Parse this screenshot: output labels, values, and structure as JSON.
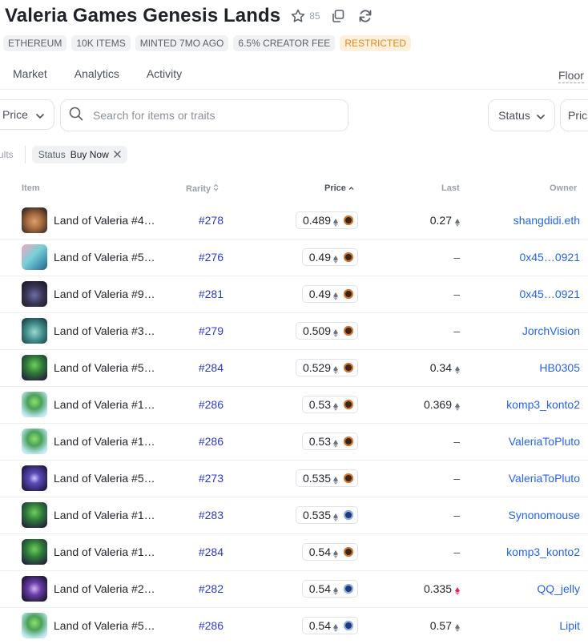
{
  "collection": {
    "title": "Valeria Games Genesis Lands",
    "favorites_count": "85"
  },
  "chips": [
    {
      "label": "ETHEREUM"
    },
    {
      "label": "10K ITEMS"
    },
    {
      "label": "MINTED 7MO AGO"
    },
    {
      "label": "6.5% CREATOR FEE"
    },
    {
      "label": "RESTRICTED"
    }
  ],
  "tabs": [
    {
      "label": "Market"
    },
    {
      "label": "Analytics"
    },
    {
      "label": "Activity"
    }
  ],
  "floor_label": "Floor",
  "filters": {
    "price_dropdown": "Price",
    "search_placeholder": "Search for items or traits",
    "status_dropdown": "Status",
    "price_dropdown_right": "Pric",
    "results_text": "ults",
    "active_filter_key": "Status",
    "active_filter_value": "Buy Now"
  },
  "table": {
    "headers": {
      "item": "Item",
      "rarity": "Rarity",
      "price": "Price",
      "last": "Last",
      "owner": "Owner"
    },
    "rows": [
      {
        "name": "Land of Valeria #4…",
        "rarity": "#278",
        "price": "0.489",
        "pay": "orange",
        "last": "0.27",
        "last_color": "#6b7280",
        "owner": "shangdidi.eth",
        "thumb": "desert"
      },
      {
        "name": "Land of Valeria #5…",
        "rarity": "#276",
        "price": "0.49",
        "pay": "orange",
        "last": "–",
        "last_color": "",
        "owner": "0x45…0921",
        "thumb": "pink"
      },
      {
        "name": "Land of Valeria #9…",
        "rarity": "#281",
        "price": "0.49",
        "pay": "orange",
        "last": "–",
        "last_color": "",
        "owner": "0x45…0921",
        "thumb": "dark"
      },
      {
        "name": "Land of Valeria #3…",
        "rarity": "#279",
        "price": "0.509",
        "pay": "orange",
        "last": "–",
        "last_color": "",
        "owner": "JorchVision",
        "thumb": "teal"
      },
      {
        "name": "Land of Valeria #5…",
        "rarity": "#284",
        "price": "0.529",
        "pay": "orange",
        "last": "0.34",
        "last_color": "#6b7280",
        "owner": "HB0305",
        "thumb": "forest"
      },
      {
        "name": "Land of Valeria #1…",
        "rarity": "#286",
        "price": "0.53",
        "pay": "orange",
        "last": "0.369",
        "last_color": "#6b7280",
        "owner": "komp3_konto2",
        "thumb": "meadow"
      },
      {
        "name": "Land of Valeria #1…",
        "rarity": "#286",
        "price": "0.53",
        "pay": "orange",
        "last": "–",
        "last_color": "",
        "owner": "ValeriaToPluto",
        "thumb": "meadow"
      },
      {
        "name": "Land of Valeria #5…",
        "rarity": "#273",
        "price": "0.535",
        "pay": "orange",
        "last": "–",
        "last_color": "",
        "owner": "ValeriaToPluto",
        "thumb": "storm"
      },
      {
        "name": "Land of Valeria #1…",
        "rarity": "#283",
        "price": "0.535",
        "pay": "blue",
        "last": "–",
        "last_color": "",
        "owner": "Synonomouse",
        "thumb": "forest"
      },
      {
        "name": "Land of Valeria #1…",
        "rarity": "#284",
        "price": "0.54",
        "pay": "orange",
        "last": "–",
        "last_color": "",
        "owner": "komp3_konto2",
        "thumb": "forest"
      },
      {
        "name": "Land of Valeria #2…",
        "rarity": "#282",
        "price": "0.54",
        "pay": "blue",
        "last": "0.335",
        "last_color": "#e0245e",
        "owner": "QQ_jelly",
        "thumb": "purple"
      },
      {
        "name": "Land of Valeria #5…",
        "rarity": "#286",
        "price": "0.54",
        "pay": "blue",
        "last": "0.57",
        "last_color": "#6b7280",
        "owner": "Lipit",
        "thumb": "meadow"
      }
    ]
  }
}
